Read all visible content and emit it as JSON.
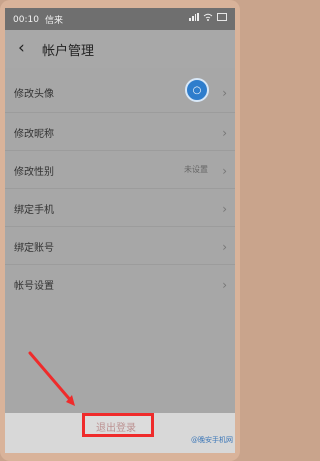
{
  "status_bar": {
    "time": "00:10",
    "carrier": "信来",
    "battery_icon": "battery-icon",
    "wifi_icon": "wifi-icon",
    "signal_icon": "signal-icon"
  },
  "header": {
    "back_icon": "back-icon",
    "title": "帐户管理"
  },
  "menu": [
    {
      "label": "修改头像",
      "kind": "avatar"
    },
    {
      "label": "修改昵称",
      "kind": "plain"
    },
    {
      "label": "修改性别",
      "kind": "value",
      "value": "未设置"
    },
    {
      "label": "绑定手机",
      "kind": "plain"
    },
    {
      "label": "绑定账号",
      "kind": "plain"
    },
    {
      "label": "帐号设置",
      "kind": "plain"
    }
  ],
  "footer": {
    "logout_label": "退出登录",
    "watermark": "@晚安手机网"
  },
  "colors": {
    "highlight": "#ef2b2b",
    "avatar": "#2e7dcc"
  }
}
